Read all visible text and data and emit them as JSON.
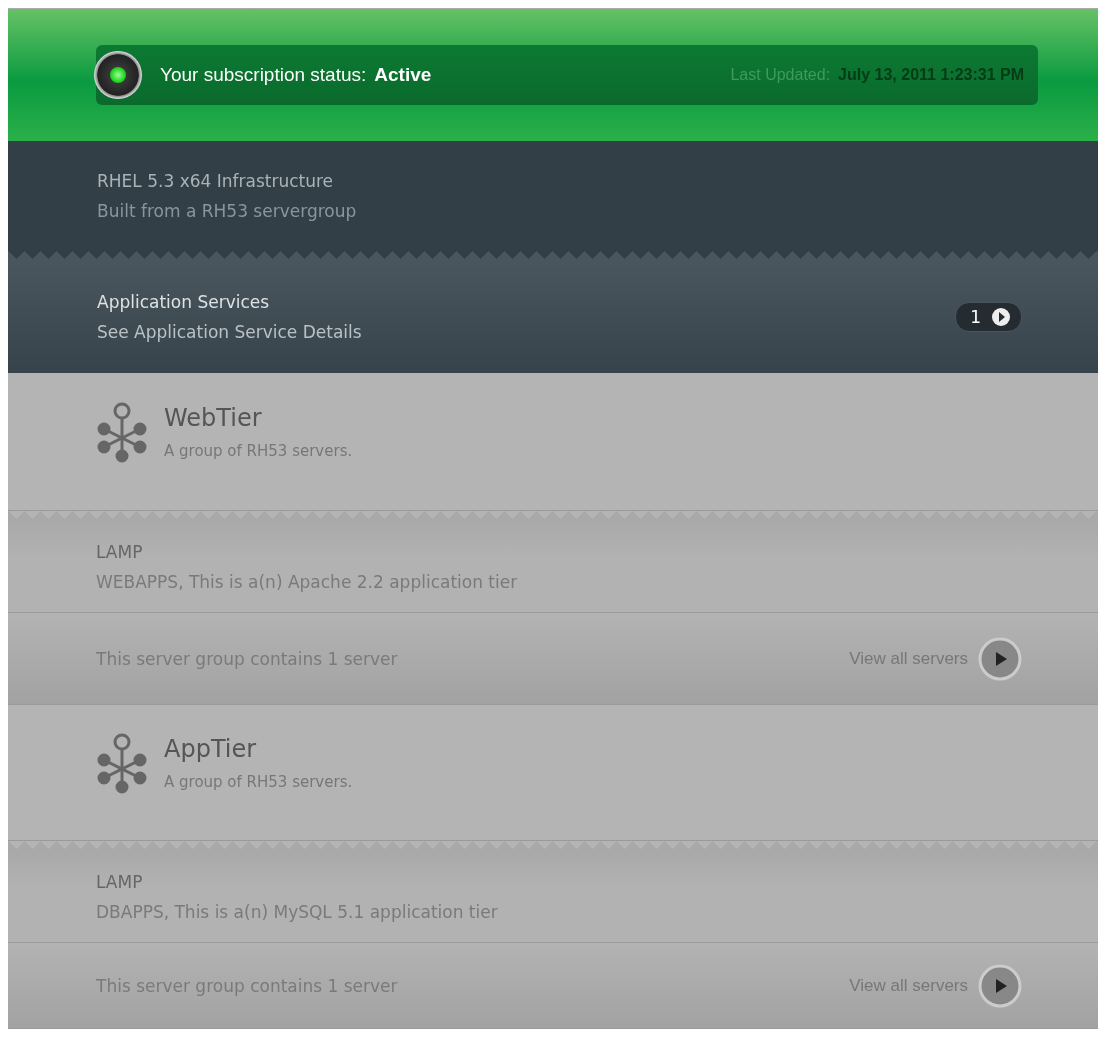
{
  "status_bar": {
    "indicator_on": true,
    "label": "Your subscription status:",
    "status": "Active",
    "updated_label": "Last Updated:",
    "updated_value": "July 13, 2011 1:23:31 PM"
  },
  "infrastructure": {
    "title": "RHEL 5.3 x64 Infrastructure",
    "subtitle": "Built from a RH53 servergroup"
  },
  "application_services": {
    "title": "Application Services",
    "subtitle": "See Application Service Details",
    "count": "1"
  },
  "server_groups": [
    {
      "name": "WebTier",
      "description": "A group of RH53 servers.",
      "stack": "LAMP",
      "stack_description": "WEBAPPS, This is a(n) Apache 2.2 application tier",
      "summary": "This server group contains 1 server",
      "link": "View all servers"
    },
    {
      "name": "AppTier",
      "description": "A group of RH53 servers.",
      "stack": "LAMP",
      "stack_description": "DBAPPS, This is a(n) MySQL 5.1 application tier",
      "summary": "This server group contains 1 server",
      "link": "View all servers"
    }
  ]
}
